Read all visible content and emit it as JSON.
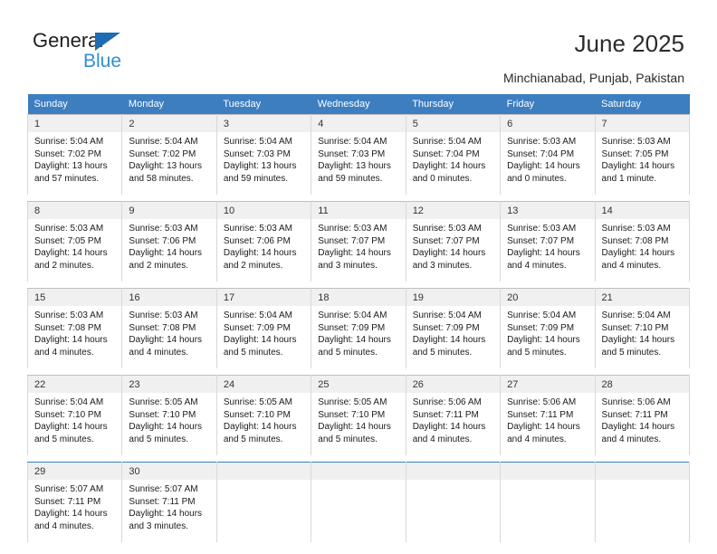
{
  "logo": {
    "word_general": "General",
    "word_blue": "Blue",
    "triangle_color": "#1d6cb5",
    "blue_text_color": "#2f8fd4"
  },
  "header": {
    "title": "June 2025",
    "subtitle": "Minchianabad, Punjab, Pakistan"
  },
  "theme": {
    "header_bg": "#3c7ec0",
    "header_text": "#ffffff",
    "daynum_bg": "#f0f0f0",
    "cell_bg": "#ffffff",
    "border": "#d8d8d8"
  },
  "weekday_headers": [
    "Sunday",
    "Monday",
    "Tuesday",
    "Wednesday",
    "Thursday",
    "Friday",
    "Saturday"
  ],
  "weeks": [
    [
      {
        "day": "1",
        "sunrise": "Sunrise: 5:04 AM",
        "sunset": "Sunset: 7:02 PM",
        "daylight": "Daylight: 13 hours and 57 minutes."
      },
      {
        "day": "2",
        "sunrise": "Sunrise: 5:04 AM",
        "sunset": "Sunset: 7:02 PM",
        "daylight": "Daylight: 13 hours and 58 minutes."
      },
      {
        "day": "3",
        "sunrise": "Sunrise: 5:04 AM",
        "sunset": "Sunset: 7:03 PM",
        "daylight": "Daylight: 13 hours and 59 minutes."
      },
      {
        "day": "4",
        "sunrise": "Sunrise: 5:04 AM",
        "sunset": "Sunset: 7:03 PM",
        "daylight": "Daylight: 13 hours and 59 minutes."
      },
      {
        "day": "5",
        "sunrise": "Sunrise: 5:04 AM",
        "sunset": "Sunset: 7:04 PM",
        "daylight": "Daylight: 14 hours and 0 minutes."
      },
      {
        "day": "6",
        "sunrise": "Sunrise: 5:03 AM",
        "sunset": "Sunset: 7:04 PM",
        "daylight": "Daylight: 14 hours and 0 minutes."
      },
      {
        "day": "7",
        "sunrise": "Sunrise: 5:03 AM",
        "sunset": "Sunset: 7:05 PM",
        "daylight": "Daylight: 14 hours and 1 minute."
      }
    ],
    [
      {
        "day": "8",
        "sunrise": "Sunrise: 5:03 AM",
        "sunset": "Sunset: 7:05 PM",
        "daylight": "Daylight: 14 hours and 2 minutes."
      },
      {
        "day": "9",
        "sunrise": "Sunrise: 5:03 AM",
        "sunset": "Sunset: 7:06 PM",
        "daylight": "Daylight: 14 hours and 2 minutes."
      },
      {
        "day": "10",
        "sunrise": "Sunrise: 5:03 AM",
        "sunset": "Sunset: 7:06 PM",
        "daylight": "Daylight: 14 hours and 2 minutes."
      },
      {
        "day": "11",
        "sunrise": "Sunrise: 5:03 AM",
        "sunset": "Sunset: 7:07 PM",
        "daylight": "Daylight: 14 hours and 3 minutes."
      },
      {
        "day": "12",
        "sunrise": "Sunrise: 5:03 AM",
        "sunset": "Sunset: 7:07 PM",
        "daylight": "Daylight: 14 hours and 3 minutes."
      },
      {
        "day": "13",
        "sunrise": "Sunrise: 5:03 AM",
        "sunset": "Sunset: 7:07 PM",
        "daylight": "Daylight: 14 hours and 4 minutes."
      },
      {
        "day": "14",
        "sunrise": "Sunrise: 5:03 AM",
        "sunset": "Sunset: 7:08 PM",
        "daylight": "Daylight: 14 hours and 4 minutes."
      }
    ],
    [
      {
        "day": "15",
        "sunrise": "Sunrise: 5:03 AM",
        "sunset": "Sunset: 7:08 PM",
        "daylight": "Daylight: 14 hours and 4 minutes."
      },
      {
        "day": "16",
        "sunrise": "Sunrise: 5:03 AM",
        "sunset": "Sunset: 7:08 PM",
        "daylight": "Daylight: 14 hours and 4 minutes."
      },
      {
        "day": "17",
        "sunrise": "Sunrise: 5:04 AM",
        "sunset": "Sunset: 7:09 PM",
        "daylight": "Daylight: 14 hours and 5 minutes."
      },
      {
        "day": "18",
        "sunrise": "Sunrise: 5:04 AM",
        "sunset": "Sunset: 7:09 PM",
        "daylight": "Daylight: 14 hours and 5 minutes."
      },
      {
        "day": "19",
        "sunrise": "Sunrise: 5:04 AM",
        "sunset": "Sunset: 7:09 PM",
        "daylight": "Daylight: 14 hours and 5 minutes."
      },
      {
        "day": "20",
        "sunrise": "Sunrise: 5:04 AM",
        "sunset": "Sunset: 7:09 PM",
        "daylight": "Daylight: 14 hours and 5 minutes."
      },
      {
        "day": "21",
        "sunrise": "Sunrise: 5:04 AM",
        "sunset": "Sunset: 7:10 PM",
        "daylight": "Daylight: 14 hours and 5 minutes."
      }
    ],
    [
      {
        "day": "22",
        "sunrise": "Sunrise: 5:04 AM",
        "sunset": "Sunset: 7:10 PM",
        "daylight": "Daylight: 14 hours and 5 minutes."
      },
      {
        "day": "23",
        "sunrise": "Sunrise: 5:05 AM",
        "sunset": "Sunset: 7:10 PM",
        "daylight": "Daylight: 14 hours and 5 minutes."
      },
      {
        "day": "24",
        "sunrise": "Sunrise: 5:05 AM",
        "sunset": "Sunset: 7:10 PM",
        "daylight": "Daylight: 14 hours and 5 minutes."
      },
      {
        "day": "25",
        "sunrise": "Sunrise: 5:05 AM",
        "sunset": "Sunset: 7:10 PM",
        "daylight": "Daylight: 14 hours and 5 minutes."
      },
      {
        "day": "26",
        "sunrise": "Sunrise: 5:06 AM",
        "sunset": "Sunset: 7:11 PM",
        "daylight": "Daylight: 14 hours and 4 minutes."
      },
      {
        "day": "27",
        "sunrise": "Sunrise: 5:06 AM",
        "sunset": "Sunset: 7:11 PM",
        "daylight": "Daylight: 14 hours and 4 minutes."
      },
      {
        "day": "28",
        "sunrise": "Sunrise: 5:06 AM",
        "sunset": "Sunset: 7:11 PM",
        "daylight": "Daylight: 14 hours and 4 minutes."
      }
    ],
    [
      {
        "day": "29",
        "sunrise": "Sunrise: 5:07 AM",
        "sunset": "Sunset: 7:11 PM",
        "daylight": "Daylight: 14 hours and 4 minutes."
      },
      {
        "day": "30",
        "sunrise": "Sunrise: 5:07 AM",
        "sunset": "Sunset: 7:11 PM",
        "daylight": "Daylight: 14 hours and 3 minutes."
      },
      {
        "day": "",
        "sunrise": "",
        "sunset": "",
        "daylight": ""
      },
      {
        "day": "",
        "sunrise": "",
        "sunset": "",
        "daylight": ""
      },
      {
        "day": "",
        "sunrise": "",
        "sunset": "",
        "daylight": ""
      },
      {
        "day": "",
        "sunrise": "",
        "sunset": "",
        "daylight": ""
      },
      {
        "day": "",
        "sunrise": "",
        "sunset": "",
        "daylight": ""
      }
    ]
  ]
}
